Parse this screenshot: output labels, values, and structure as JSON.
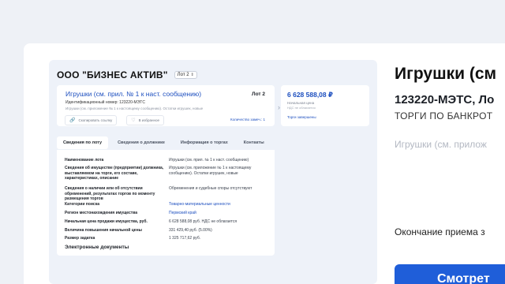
{
  "company": {
    "name": "ООО \"БИЗНЕС АКТИВ\"",
    "lot_select": "Лот 2"
  },
  "lot": {
    "title": "Игрушки (см. прил. № 1 к наст. сообщению)",
    "number": "Лот 2",
    "id_line": "Идентификационный номер: 123220-МЭТС",
    "description": "Игрушки (см. приложение № 1 к настоящему сообщению). Остатки игрушек, новые",
    "copy_link_label": "Скопировать ссылку",
    "favorites_label": "В избранное",
    "protocols_label": "Количество замеч.: 1"
  },
  "price": {
    "value": "6 628 588,08 ₽",
    "label": "Начальная цена",
    "vat": "НДС не облагается",
    "status": "Торги завершены"
  },
  "tabs": [
    "Сведения по лоту",
    "Сведения о должнике",
    "Информация о торгах",
    "Контакты"
  ],
  "details": [
    {
      "k": "Наименование лота",
      "v": "Игрушки (см. прил. № 1 к наст. сообщению)"
    },
    {
      "k": "Сведения об имуществе (предприятии) должника, выставляемом на торги, его составе, характеристиках, описание",
      "v": "Игрушки (см. приложение № 1 к настоящему сообщению). Остатки игрушек, новые"
    },
    {
      "k": "Сведения о наличии или об отсутствии обременений, результатах торгов по моменту размещения торгов",
      "v": "Обременения и судебные споры отсутствуют"
    },
    {
      "k": "Категории поиска",
      "v": "Товарно-материальные ценности"
    },
    {
      "k": "Регион местонахождения имущества",
      "v": "Пермский край"
    },
    {
      "k": "Начальная цена продажи имущества, руб.",
      "v": "6 628 588,08 руб. НДС не облагается"
    },
    {
      "k": "Величина повышения начальной цены",
      "v": "331 429,40 руб. (5.00%)"
    },
    {
      "k": "Размер задатка",
      "v": "1 325 717,62 руб."
    }
  ],
  "docs_title": "Электронные документы",
  "right": {
    "title": "Игрушки (см",
    "subtitle": "123220-МЭТС, Ло",
    "type": "ТОРГИ ПО БАНКРОТ",
    "desc": "Игрушки (см. прилож",
    "end": "Окончание приема з",
    "button": "Смотрет"
  }
}
